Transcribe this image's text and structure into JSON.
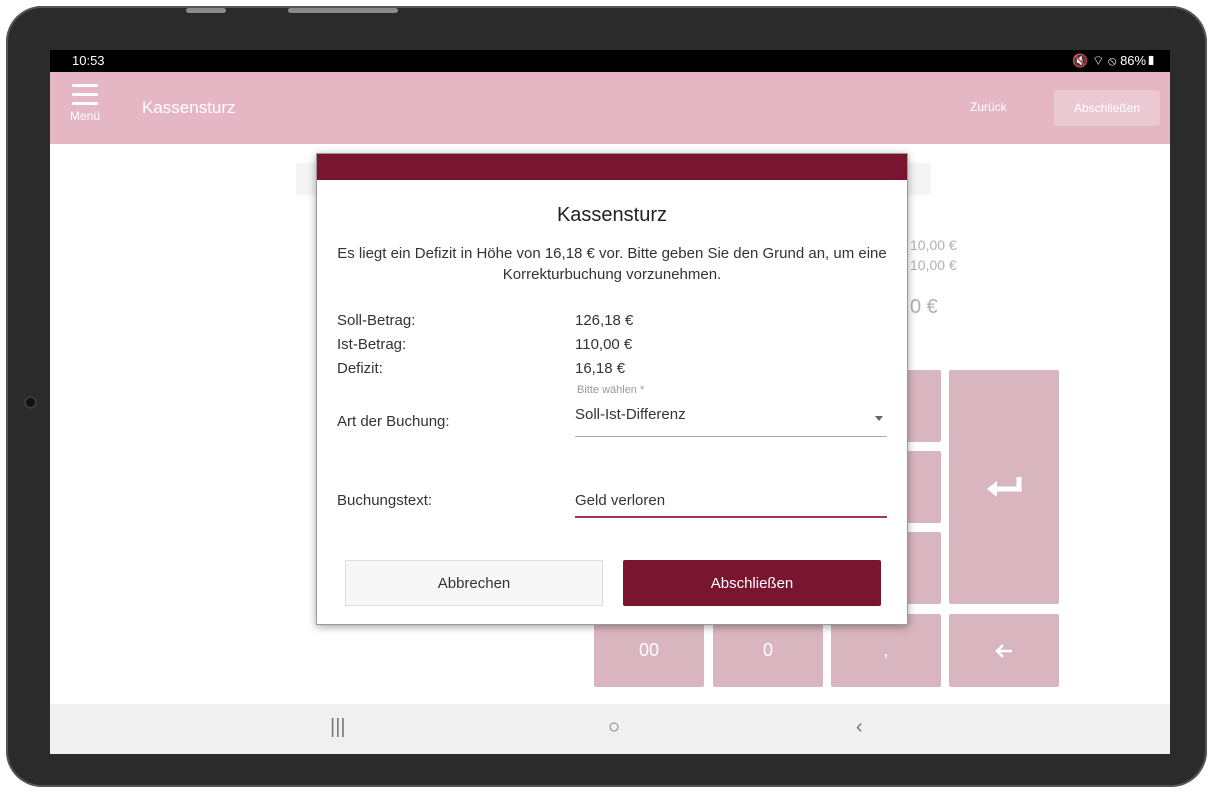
{
  "status_bar": {
    "time": "10:53",
    "icons": "🔇 ⌔ ⦸ 86%▮"
  },
  "app_bar": {
    "menu_label": "Menü",
    "title": "Kassensturz",
    "back_label": "Zurück",
    "finish_label": "Abschließen"
  },
  "background": {
    "amount1": "10,00 €",
    "amount2": "10,00 €",
    "amount_big": "0 €"
  },
  "keypad": {
    "key_00": "00",
    "key_0": "0",
    "key_comma": ",",
    "enter_icon": "enter-icon",
    "backspace_icon": "arrow-left-icon"
  },
  "dialog": {
    "title": "Kassensturz",
    "message": "Es liegt ein Defizit in Höhe von 16,18 € vor. Bitte geben Sie den Grund an, um eine Korrekturbuchung vorzunehmen.",
    "soll_label": "Soll-Betrag:",
    "soll_value": "126,18 €",
    "ist_label": "Ist-Betrag:",
    "ist_value": "110,00 €",
    "defizit_label": "Defizit:",
    "defizit_value": "16,18 €",
    "booking_type_hint": "Bitte wählen *",
    "booking_type_label": "Art der Buchung:",
    "booking_type_value": "Soll-Ist-Differenz",
    "booking_text_label": "Buchungstext:",
    "booking_text_value": "Geld verloren",
    "cancel_label": "Abbrechen",
    "finish_label": "Abschließen"
  },
  "nav": {
    "recents": "|||",
    "home": "○",
    "back": "‹"
  },
  "colors": {
    "accent": "#7a1530",
    "app_bar": "#e5b7c4",
    "keypad": "#d9b5bf"
  }
}
